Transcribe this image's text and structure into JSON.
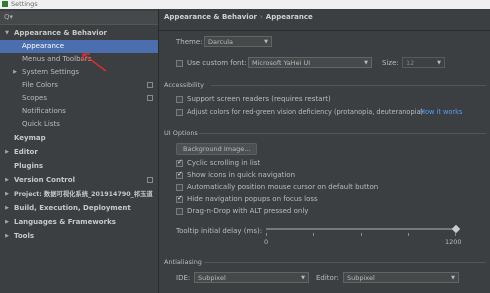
{
  "window": {
    "title": "Settings"
  },
  "search": {
    "icon": "search-icon",
    "value": ""
  },
  "sidebar": {
    "items": [
      {
        "label": "Appearance & Behavior",
        "expanded": true,
        "bold": true
      },
      {
        "label": "Appearance",
        "selected": true
      },
      {
        "label": "Menus and Toolbars"
      },
      {
        "label": "System Settings",
        "collapsed": true
      },
      {
        "label": "File Colors"
      },
      {
        "label": "Scopes"
      },
      {
        "label": "Notifications"
      },
      {
        "label": "Quick Lists"
      },
      {
        "label": "Keymap",
        "bold": true
      },
      {
        "label": "Editor",
        "bold": true
      },
      {
        "label": "Plugins",
        "bold": true
      },
      {
        "label": "Version Control",
        "bold": true
      },
      {
        "label": "Project: 数据可视化系统_201914790_祁玉道",
        "bold": true
      },
      {
        "label": "Build, Execution, Deployment",
        "bold": true
      },
      {
        "label": "Languages & Frameworks",
        "bold": true
      },
      {
        "label": "Tools",
        "bold": true
      }
    ]
  },
  "breadcrumb": {
    "parent": "Appearance & Behavior",
    "sep": "›",
    "current": "Appearance"
  },
  "appearance": {
    "theme_label": "Theme:",
    "theme_value": "Darcula",
    "custom_font_label": "Use custom font:",
    "custom_font_checked": false,
    "font_value": "Microsoft YaHei UI",
    "size_label": "Size:",
    "size_value": "12"
  },
  "accessibility": {
    "section": "Accessibility",
    "screen_readers": "Support screen readers (requires restart)",
    "color_adjust": "Adjust colors for red-green vision deficiency (protanopia, deuteranopia)",
    "how_it_works": "How it works"
  },
  "ui_options": {
    "section": "UI Options",
    "background_image_button": "Background Image...",
    "options": [
      {
        "label": "Cyclic scrolling in list",
        "checked": true
      },
      {
        "label": "Show icons in quick navigation",
        "checked": true
      },
      {
        "label": "Automatically position mouse cursor on default button",
        "checked": false
      },
      {
        "label": "Hide navigation popups on focus loss",
        "checked": true
      },
      {
        "label": "Drag-n-Drop with ALT pressed only",
        "checked": false
      }
    ],
    "tooltip_label": "Tooltip initial delay (ms):",
    "tooltip_min": "0",
    "tooltip_max": "1200",
    "tooltip_value_fraction": 1.0
  },
  "antialiasing": {
    "section": "Antialiasing",
    "ide_label": "IDE:",
    "ide_value": "Subpixel",
    "editor_label": "Editor:",
    "editor_value": "Subpixel"
  },
  "colors": {
    "selection": "#4b6eaf",
    "link": "#589df6",
    "annotation": "#d32f2f"
  }
}
